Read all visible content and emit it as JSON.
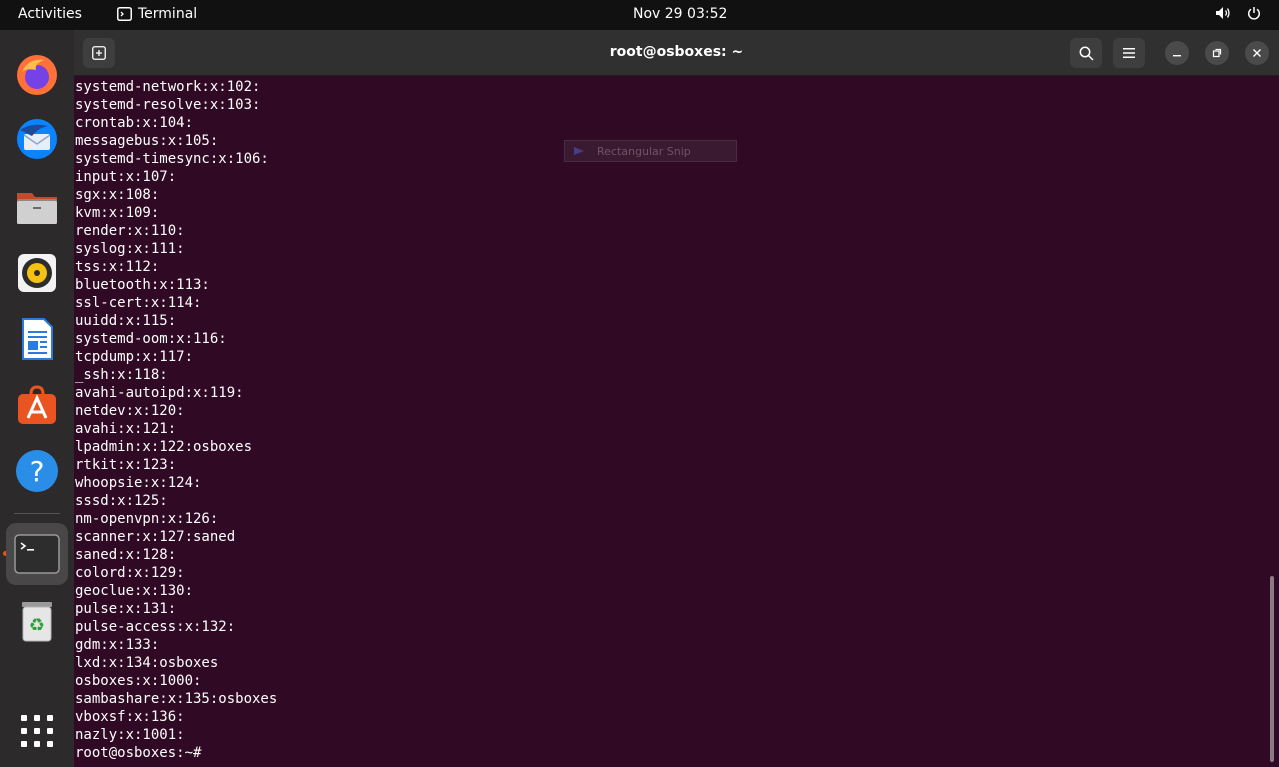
{
  "topbar": {
    "activities": "Activities",
    "app_name": "Terminal",
    "clock": "Nov 29  03:52"
  },
  "dock": {
    "items": [
      {
        "name": "firefox-icon",
        "color": "#ff7139"
      },
      {
        "name": "thunderbird-icon",
        "color": "#0a84ff"
      },
      {
        "name": "files-icon",
        "color": "#e95420"
      },
      {
        "name": "rhythmbox-icon",
        "color": "#f5c211"
      },
      {
        "name": "libreoffice-writer-icon",
        "color": "#2a7bde"
      },
      {
        "name": "ubuntu-software-icon",
        "color": "#e95420"
      },
      {
        "name": "help-icon",
        "color": "#2a8ee8"
      },
      {
        "name": "terminal-icon",
        "color": "#2d2d2d"
      },
      {
        "name": "trash-icon",
        "color": "#2e9d3a"
      },
      {
        "name": "show-apps-icon",
        "color": "#ffffff"
      }
    ]
  },
  "window": {
    "title": "root@osboxes: ~"
  },
  "snip_overlay": {
    "label": "Rectangular Snip"
  },
  "terminal": {
    "lines": [
      "systemd-network:x:102:",
      "systemd-resolve:x:103:",
      "crontab:x:104:",
      "messagebus:x:105:",
      "systemd-timesync:x:106:",
      "input:x:107:",
      "sgx:x:108:",
      "kvm:x:109:",
      "render:x:110:",
      "syslog:x:111:",
      "tss:x:112:",
      "bluetooth:x:113:",
      "ssl-cert:x:114:",
      "uuidd:x:115:",
      "systemd-oom:x:116:",
      "tcpdump:x:117:",
      "_ssh:x:118:",
      "avahi-autoipd:x:119:",
      "netdev:x:120:",
      "avahi:x:121:",
      "lpadmin:x:122:osboxes",
      "rtkit:x:123:",
      "whoopsie:x:124:",
      "sssd:x:125:",
      "nm-openvpn:x:126:",
      "scanner:x:127:saned",
      "saned:x:128:",
      "colord:x:129:",
      "geoclue:x:130:",
      "pulse:x:131:",
      "pulse-access:x:132:",
      "gdm:x:133:",
      "lxd:x:134:osboxes",
      "osboxes:x:1000:",
      "sambashare:x:135:osboxes",
      "vboxsf:x:136:",
      "nazly:x:1001:",
      "root@osboxes:~#"
    ]
  }
}
